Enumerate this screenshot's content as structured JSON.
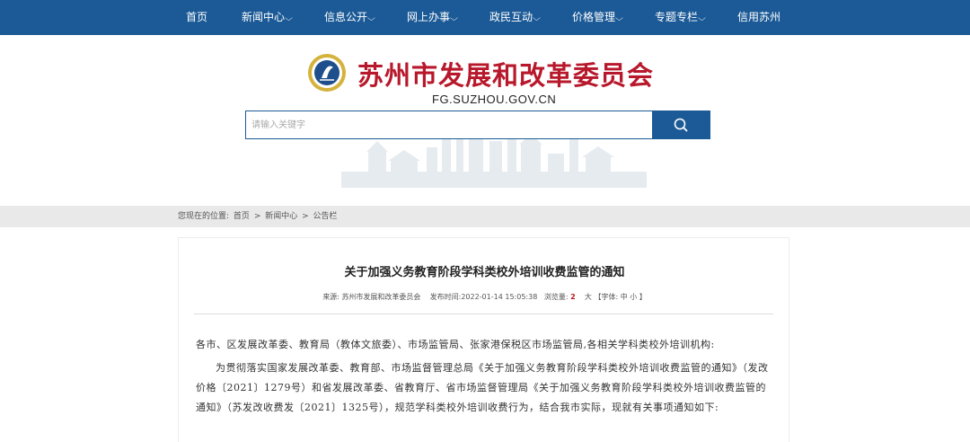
{
  "nav": {
    "items": [
      {
        "label": "首页",
        "has_dropdown": false
      },
      {
        "label": "新闻中心",
        "has_dropdown": true
      },
      {
        "label": "信息公开",
        "has_dropdown": true
      },
      {
        "label": "网上办事",
        "has_dropdown": true
      },
      {
        "label": "政民互动",
        "has_dropdown": true
      },
      {
        "label": "价格管理",
        "has_dropdown": true
      },
      {
        "label": "专题专栏",
        "has_dropdown": true
      },
      {
        "label": "信用苏州",
        "has_dropdown": false
      }
    ],
    "dropdown_glyph": "v"
  },
  "header": {
    "title": "苏州市发展和改革委员会",
    "domain": "FG.SUZHOU.GOV.CN"
  },
  "search": {
    "placeholder": "请输入关键字",
    "button_icon": "search-icon"
  },
  "breadcrumb": {
    "prefix": "您现在的位置:",
    "items": [
      "首页",
      "新闻中心",
      "公告栏"
    ],
    "separator": ">"
  },
  "article": {
    "title": "关于加强义务教育阶段学科类校外培训收费监管的通知",
    "meta": {
      "source_label": "来源:",
      "source": "苏州市发展和改革委员会",
      "time_label": "发布时间:",
      "time": "2022-01-14 15:05:38",
      "views_label": "浏览量:",
      "views": "2",
      "font_label": "大 【字体: 中 小 】"
    },
    "greeting": "各市、区发展改革委、教育局（教体文旅委）、市场监管局、张家港保税区市场监管局,各相关学科类校外培训机构:",
    "paragraph1": "为贯彻落实国家发展改革委、教育部、市场监督管理总局《关于加强义务教育阶段学科类校外培训收费监管的通知》（发改价格〔2021〕1279号）和省发展改革委、省教育厅、省市场监督管理局《关于加强义务教育阶段学科类校外培训收费监管的通知》（苏发改收费发〔2021〕1325号），规范学科类校外培训收费行为，结合我市实际，现就有关事项通知如下:"
  },
  "colors": {
    "nav_bg": "#1b5a96",
    "title_red": "#b8182b",
    "crumb_bg": "#e9e9e9"
  }
}
